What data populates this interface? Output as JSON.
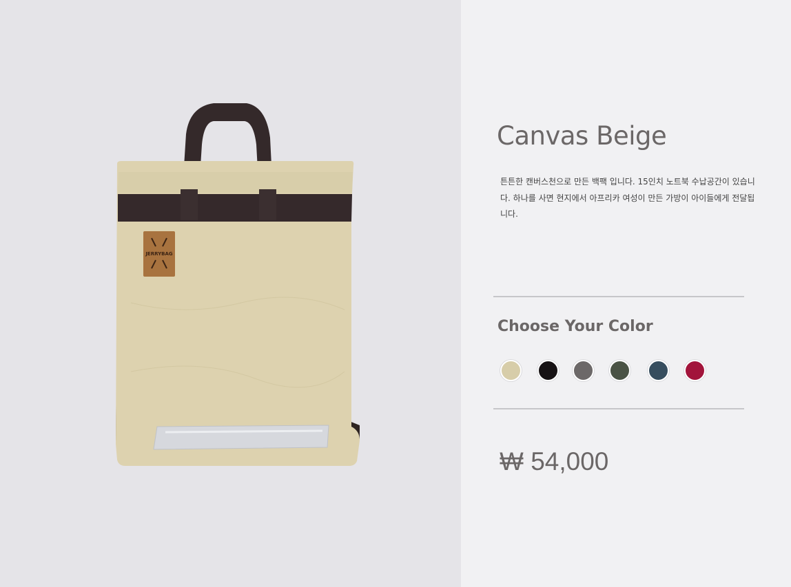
{
  "product": {
    "image_alt": "Canvas backpack in beige with dark brown straps and JERRYBAG leather patch",
    "logo_text": "JERRYBAG",
    "title": "Canvas Beige",
    "description": "튼튼한 캔버스천으로 만든 백팩 입니다. 15인치 노트북 수납공간이 있습니다. 하나를 사면 현지에서 아프리카 여성이 만든 가방이 아이들에게 전달됩니다.",
    "price": "₩ 54,000"
  },
  "color_picker": {
    "heading": "Choose Your Color",
    "swatches": [
      {
        "name": "beige",
        "hex": "#d7cda9"
      },
      {
        "name": "black",
        "hex": "#161214"
      },
      {
        "name": "gray",
        "hex": "#6c6868"
      },
      {
        "name": "olive",
        "hex": "#4a5345"
      },
      {
        "name": "navy",
        "hex": "#364d5e"
      },
      {
        "name": "burgundy",
        "hex": "#a2143b"
      }
    ]
  },
  "colors": {
    "left_panel_bg": "#e5e4e8",
    "right_panel_bg": "#f1f1f3",
    "text_gray": "#6b6767"
  }
}
